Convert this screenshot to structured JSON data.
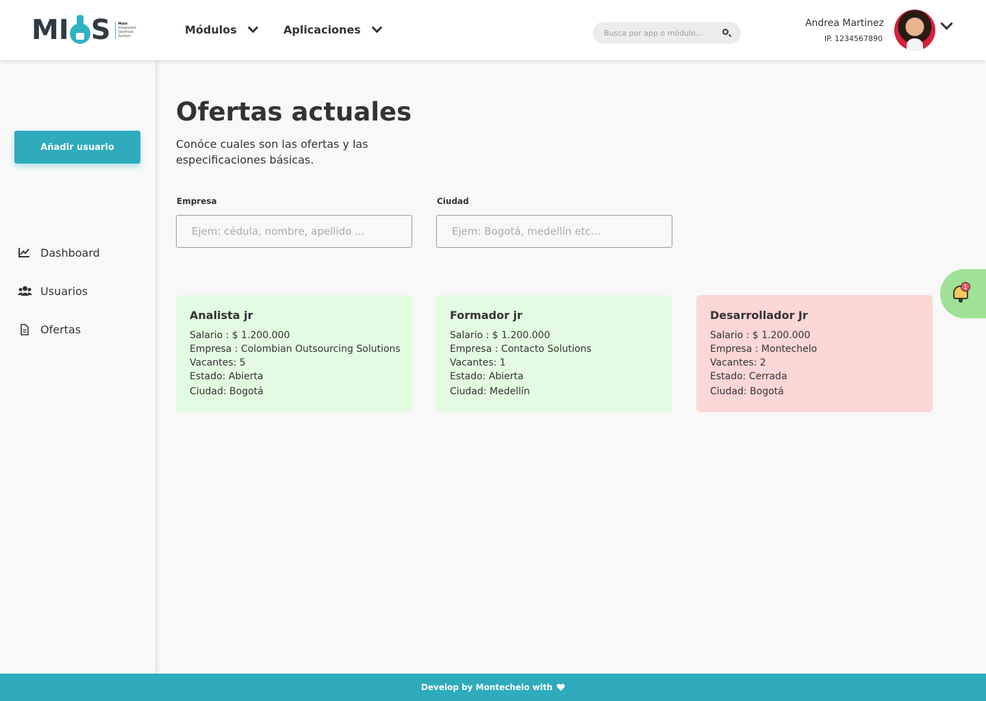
{
  "header": {
    "logo": {
      "text_left": "MI",
      "text_right": "S",
      "tagline": [
        "Main",
        "Integrated",
        "Optimize",
        "System"
      ]
    },
    "nav": [
      {
        "label": "Módulos",
        "icon": "chevron-down-icon"
      },
      {
        "label": "Aplicaciones",
        "icon": "chevron-down-icon"
      }
    ],
    "search": {
      "placeholder": "Busca por app o módulo...",
      "icon": "search-icon"
    },
    "user": {
      "name": "Andrea Martinez",
      "ip": "IP. 1234567890"
    }
  },
  "sidebar": {
    "add_button": "Añadir usuario",
    "items": [
      {
        "label": "Dashboard",
        "icon": "chart-line-icon"
      },
      {
        "label": "Usuarios",
        "icon": "users-icon"
      },
      {
        "label": "Ofertas",
        "icon": "document-icon"
      }
    ]
  },
  "main": {
    "title": "Ofertas actuales",
    "subtitle": "Conóce cuales son las ofertas y las especificaciones básicas.",
    "filters": [
      {
        "label": "Empresa",
        "placeholder": "Ejem: cédula, nombre, apellido ..."
      },
      {
        "label": "Ciudad",
        "placeholder": "Ejem: Bogotá, medellín etc..."
      }
    ],
    "offers": [
      {
        "title": "Analista jr",
        "salario": "Salario : $ 1.200.000",
        "empresa": "Empresa : Colombian Outsourcing Solutions",
        "vacantes": "Vacantes: 5",
        "estado": "Estado: Abierta",
        "ciudad": "Ciudad: Bogotá",
        "status_color": "#e3fce1"
      },
      {
        "title": "Formador jr",
        "salario": "Salario : $ 1.200.000",
        "empresa": "Empresa : Contacto Solutions",
        "vacantes": "Vacantes: 1",
        "estado": "Estado: Abierta",
        "ciudad": "Ciudad: Medellín",
        "status_color": "#e3fce1"
      },
      {
        "title": "Desarrollador Jr",
        "salario": "Salario : $ 1.200.000",
        "empresa": "Empresa : Montechelo",
        "vacantes": "Vacantes: 2",
        "estado": "Estado: Cerrada",
        "ciudad": "Ciudad: Bogotá",
        "status_color": "#fdd6d6"
      }
    ],
    "notification": {
      "icon": "bell-icon",
      "count": "1"
    }
  },
  "footer": {
    "text": "Develop by Montechelo with",
    "icon": "heart-icon"
  },
  "colors": {
    "accent": "#2eabbd",
    "open": "#e3fce1",
    "closed": "#fdd6d6",
    "notif_bg": "#9fe196"
  }
}
